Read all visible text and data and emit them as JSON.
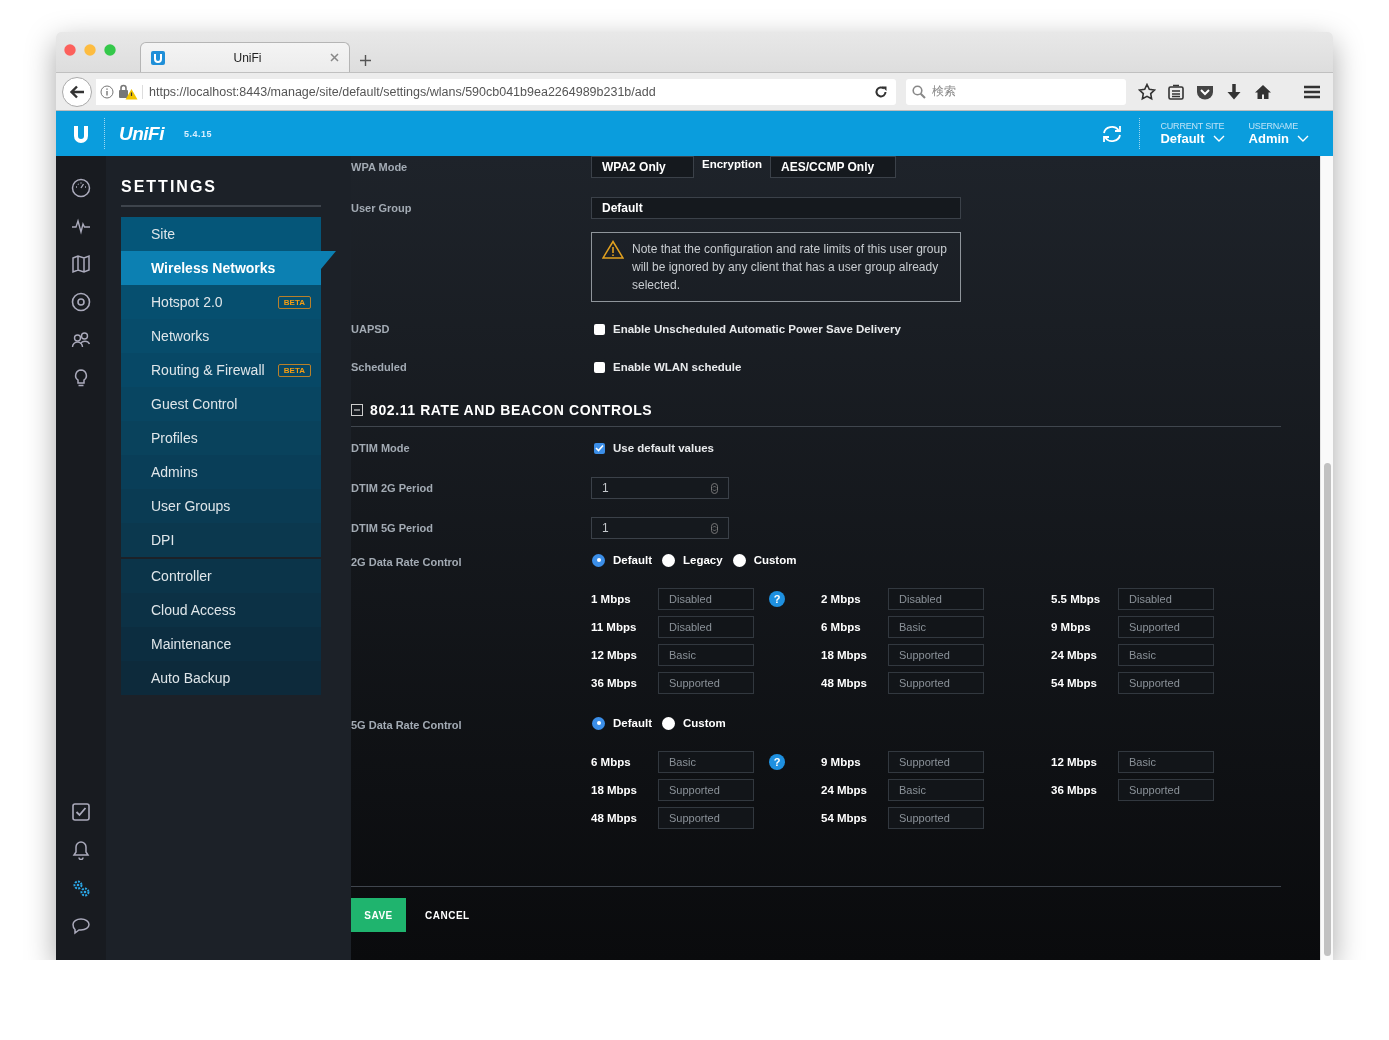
{
  "browser": {
    "tab_title": "UniFi",
    "url": "https://localhost:8443/manage/site/default/settings/wlans/590cb041b9ea2264989b231b/add",
    "search_placeholder": "検索"
  },
  "header": {
    "logo": "UniFi",
    "version": "5.4.15",
    "site_label": "CURRENT SITE",
    "site": "Default",
    "user_label": "USERNAME",
    "user": "Admin"
  },
  "rail": {
    "top": [
      {
        "kind": "dashboard",
        "selected": false
      },
      {
        "kind": "pulse",
        "selected": false
      },
      {
        "kind": "map",
        "selected": false
      },
      {
        "kind": "target",
        "selected": false
      },
      {
        "kind": "users",
        "selected": false
      },
      {
        "kind": "bulb",
        "selected": false
      }
    ],
    "bottom": [
      {
        "kind": "tasks",
        "selected": false
      },
      {
        "kind": "bell",
        "selected": false
      },
      {
        "kind": "gears",
        "selected": true
      },
      {
        "kind": "chat",
        "selected": false
      }
    ]
  },
  "settings": {
    "title": "SETTINGS",
    "groups": [
      {
        "items": [
          {
            "label": "Site",
            "selected": false
          },
          {
            "label": "Wireless Networks",
            "selected": true
          },
          {
            "label": "Hotspot 2.0",
            "selected": false,
            "badge": "BETA"
          },
          {
            "label": "Networks",
            "selected": false
          },
          {
            "label": "Routing & Firewall",
            "selected": false,
            "badge": "BETA"
          },
          {
            "label": "Guest Control",
            "selected": false
          },
          {
            "label": "Profiles",
            "selected": false
          },
          {
            "label": "Admins",
            "selected": false
          },
          {
            "label": "User Groups",
            "selected": false
          },
          {
            "label": "DPI",
            "selected": false
          }
        ]
      },
      {
        "items": [
          {
            "label": "Controller",
            "selected": false
          },
          {
            "label": "Cloud Access",
            "selected": false
          },
          {
            "label": "Maintenance",
            "selected": false
          },
          {
            "label": "Auto Backup",
            "selected": false
          }
        ]
      }
    ]
  },
  "form": {
    "rows": [
      {
        "kind": "select_pair",
        "label": "WPA Mode",
        "value": "WPA2 Only",
        "sublabel": "Encryption",
        "value2": "AES/CCMP Only"
      },
      {
        "kind": "select",
        "label": "User Group",
        "value": "Default"
      },
      {
        "kind": "note",
        "text": "Note that the configuration and rate limits of this user group will be ignored by any client that has a user group already selected."
      },
      {
        "kind": "checkbox",
        "label": "UAPSD",
        "text": "Enable Unscheduled Automatic Power Save Delivery",
        "checked": false
      },
      {
        "kind": "checkbox",
        "label": "Scheduled",
        "text": "Enable WLAN schedule",
        "checked": false
      },
      {
        "kind": "section",
        "title": "802.11 RATE AND BEACON CONTROLS",
        "expanded": true
      },
      {
        "kind": "checkbox",
        "label": "DTIM Mode",
        "text": "Use default values",
        "checked": true
      },
      {
        "kind": "number",
        "label": "DTIM 2G Period",
        "value": "1"
      },
      {
        "kind": "number",
        "label": "DTIM 5G Period",
        "value": "1"
      },
      {
        "kind": "radio",
        "label": "2G Data Rate Control",
        "help": "?",
        "options": [
          {
            "label": "Default",
            "selected": true
          },
          {
            "label": "Legacy",
            "selected": false
          },
          {
            "label": "Custom",
            "selected": false
          }
        ],
        "rates": [
          {
            "rate": "1 Mbps",
            "value": "Disabled"
          },
          {
            "rate": "2 Mbps",
            "value": "Disabled"
          },
          {
            "rate": "5.5 Mbps",
            "value": "Disabled"
          },
          {
            "rate": "11 Mbps",
            "value": "Disabled"
          },
          {
            "rate": "6 Mbps",
            "value": "Basic"
          },
          {
            "rate": "9 Mbps",
            "value": "Supported"
          },
          {
            "rate": "12 Mbps",
            "value": "Basic"
          },
          {
            "rate": "18 Mbps",
            "value": "Supported"
          },
          {
            "rate": "24 Mbps",
            "value": "Basic"
          },
          {
            "rate": "36 Mbps",
            "value": "Supported"
          },
          {
            "rate": "48 Mbps",
            "value": "Supported"
          },
          {
            "rate": "54 Mbps",
            "value": "Supported"
          }
        ]
      },
      {
        "kind": "radio",
        "label": "5G Data Rate Control",
        "help": "?",
        "options": [
          {
            "label": "Default",
            "selected": true
          },
          {
            "label": "Custom",
            "selected": false
          }
        ],
        "rates": [
          {
            "rate": "6 Mbps",
            "value": "Basic"
          },
          {
            "rate": "9 Mbps",
            "value": "Supported"
          },
          {
            "rate": "12 Mbps",
            "value": "Basic"
          },
          {
            "rate": "18 Mbps",
            "value": "Supported"
          },
          {
            "rate": "24 Mbps",
            "value": "Basic"
          },
          {
            "rate": "36 Mbps",
            "value": "Supported"
          },
          {
            "rate": "48 Mbps",
            "value": "Supported"
          },
          {
            "rate": "54 Mbps",
            "value": "Supported"
          }
        ]
      }
    ]
  },
  "buttons": {
    "save": "SAVE",
    "cancel": "CANCEL"
  }
}
